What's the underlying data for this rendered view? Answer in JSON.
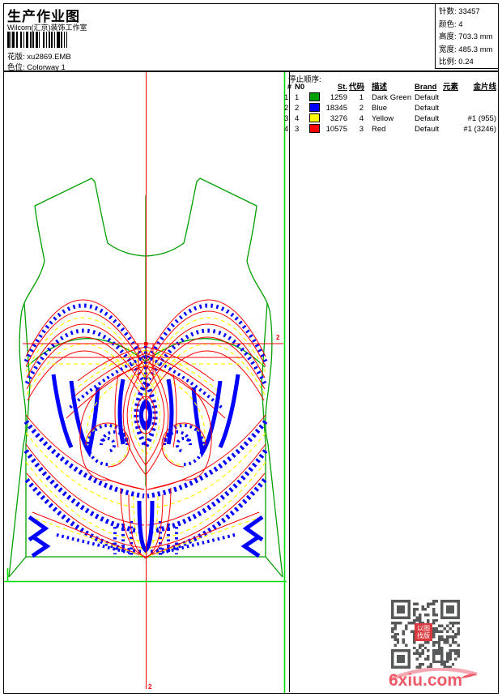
{
  "page": {
    "title": "生产作业图",
    "company": "Wilcom(汇京)装饰工作室",
    "pattern_label": "花版:",
    "pattern_value": "xu2869.EMB",
    "colorway_label": "色位:",
    "colorway_value": "Colorway 1"
  },
  "info": {
    "stitches_label": "针数:",
    "stitches": "33457",
    "colors_label": "颜色:",
    "colors": "4",
    "height_label": "高度:",
    "height": "703.3 mm",
    "width_label": "宽度:",
    "width": "485.3 mm",
    "scale_label": "比例:",
    "scale": "0.24"
  },
  "table": {
    "title": "停止顺序:",
    "headers": {
      "stop": "#",
      "needle": "N0",
      "st": "St.",
      "code": "代码",
      "desc": "描述",
      "brand": "Brand",
      "element": "元素",
      "sequin": "金片线"
    },
    "rows": [
      {
        "stop": "1.",
        "needle": "1",
        "color": "#00a000",
        "st": "1259",
        "code": "1",
        "desc": "Dark Green",
        "brand": "Default",
        "element": "",
        "sequin": ""
      },
      {
        "stop": "2.",
        "needle": "2",
        "color": "#0000ff",
        "st": "18345",
        "code": "2",
        "desc": "Blue",
        "brand": "Default",
        "element": "",
        "sequin": ""
      },
      {
        "stop": "3.",
        "needle": "4",
        "color": "#ffff00",
        "st": "3276",
        "code": "4",
        "desc": "Yellow",
        "brand": "Default",
        "element": "",
        "sequin": "#1 (955)"
      },
      {
        "stop": "4.",
        "needle": "3",
        "color": "#ff0000",
        "st": "10575",
        "code": "3",
        "desc": "Red",
        "brand": "Default",
        "element": "",
        "sequin": "#1 (3246)"
      }
    ]
  },
  "design": {
    "palette": {
      "green": "#00a000",
      "guide": "#00dd00",
      "red": "#ff0000",
      "blue": "#0000ff",
      "yellow": "#ffff00"
    },
    "marker_right": "2",
    "marker_bottom": "2"
  },
  "stamp": {
    "line1": "以图",
    "line2": "找版"
  },
  "watermark": {
    "text": "6xiu.com",
    "color": "#ee5a68"
  }
}
